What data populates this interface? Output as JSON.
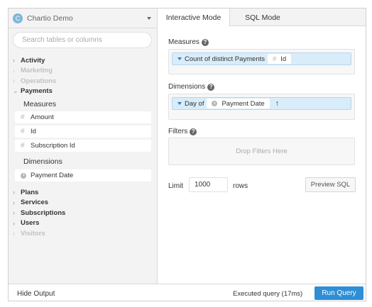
{
  "datasource": {
    "icon_letter": "C",
    "name": "Chartio Demo"
  },
  "search": {
    "placeholder": "Search tables or columns"
  },
  "tree": {
    "categories_top": [
      {
        "label": "Activity",
        "enabled": true,
        "expanded": false
      },
      {
        "label": "Marketing",
        "enabled": false,
        "expanded": false
      },
      {
        "label": "Operations",
        "enabled": false,
        "expanded": false
      },
      {
        "label": "Payments",
        "enabled": true,
        "expanded": true
      }
    ],
    "payments": {
      "measures_heading": "Measures",
      "measures": [
        "Amount",
        "Id",
        "Subscription Id"
      ],
      "dimensions_heading": "Dimensions",
      "dimensions": [
        "Payment Date"
      ]
    },
    "categories_bottom": [
      {
        "label": "Plans",
        "enabled": true
      },
      {
        "label": "Services",
        "enabled": true
      },
      {
        "label": "Subscriptions",
        "enabled": true
      },
      {
        "label": "Users",
        "enabled": true
      },
      {
        "label": "Visitors",
        "enabled": false
      }
    ]
  },
  "tabs": [
    {
      "label": "Interactive Mode",
      "active": true
    },
    {
      "label": "SQL Mode",
      "active": false
    }
  ],
  "measures": {
    "label": "Measures",
    "pill": {
      "aggregate": "Count of distinct Payments",
      "field": "Id"
    }
  },
  "dimensions": {
    "label": "Dimensions",
    "pill": {
      "aggregate": "Day of",
      "field": "Payment Date",
      "sort": "↑"
    }
  },
  "filters": {
    "label": "Filters",
    "drop_text": "Drop Filters Here"
  },
  "limit": {
    "label": "Limit",
    "value": "1000",
    "unit": "rows"
  },
  "preview_sql": "Preview SQL",
  "bottom": {
    "hide_output": "Hide Output",
    "status": "Executed query (17ms)",
    "run_query": "Run Query"
  },
  "colors": {
    "accent": "#2e8ed6",
    "pill_bg": "#d9ecf9",
    "sidebar_bg": "#f3f3f3"
  },
  "icons": {
    "help": "question-circle-icon",
    "measure": "hash-icon",
    "dimension": "clock-icon",
    "caret": "chevron-down-icon"
  }
}
